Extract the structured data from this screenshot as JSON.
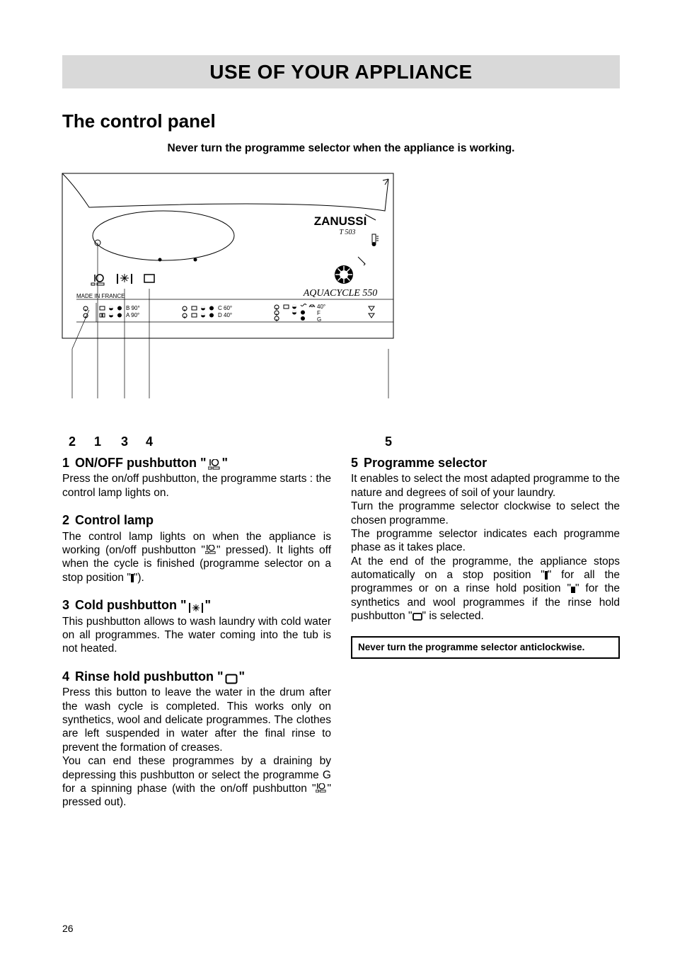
{
  "title": "USE OF YOUR APPLIANCE",
  "section": "The control panel",
  "top_warning": "Never turn the programme selector when the appliance is working.",
  "figure": {
    "brand": "ZANUSSI",
    "model": "T 503",
    "subbrand": "AQUACYCLE 550",
    "made": "MADE IN FRANCE",
    "prog_b": "B 90°",
    "prog_a": "A 90°",
    "prog_c": "C 60°",
    "prog_d": "D 40°",
    "prog_40": "40°",
    "prog_f": "F",
    "prog_g": "G"
  },
  "callouts": {
    "c1": "2",
    "c2": "1",
    "c3": "3",
    "c4": "4",
    "c5": "5"
  },
  "h1": {
    "num": "1",
    "title": "ON/OFF pushbutton \"",
    "title_after": "\""
  },
  "p1": "Press the on/off pushbutton, the programme starts : the control lamp lights on.",
  "h2": {
    "num": "2",
    "title": "Control lamp"
  },
  "p2a": "The control lamp lights on when the appliance is working (on/off pushbutton \"",
  "p2b": "\" pressed). It lights off when the cycle is finished (programme selector on a stop position \"",
  "p2c": "\").",
  "h3": {
    "num": "3",
    "title": "Cold pushbutton \"",
    "title_after": "\""
  },
  "p3": "This pushbutton allows to wash laundry with cold water on all programmes. The water coming into the tub is not heated.",
  "h4": {
    "num": "4",
    "title": "Rinse hold pushbutton \"",
    "title_after": "\""
  },
  "p4": "Press this button to leave the water in the drum after the wash cycle is completed. This works only on synthetics, wool and delicate programmes. The clothes are left suspended in water after the final rinse to prevent the formation of creases.",
  "p4b_a": "You can end these programmes by a draining by depressing this pushbutton or select the programme G for a spinning phase (with the on/off pushbutton \"",
  "p4b_b": "\" pressed out).",
  "h5": {
    "num": "5",
    "title": "Programme selector"
  },
  "p5a": "It enables to select the most adapted programme to the nature and degrees of soil of your laundry.",
  "p5b": "Turn the programme selector clockwise to select the chosen programme.",
  "p5c": "The programme selector indicates each programme phase as it takes place.",
  "p5d_a": "At the end of the programme, the appliance stops automatically on a stop position \"",
  "p5d_b": "\" for all the programmes or on a rinse hold position \"",
  "p5d_c": "\" for the synthetics and wool programmes if the rinse hold pushbutton \"",
  "p5d_d": "\" is selected.",
  "box_warning": "Never turn the programme selector anticlockwise.",
  "page": "26"
}
